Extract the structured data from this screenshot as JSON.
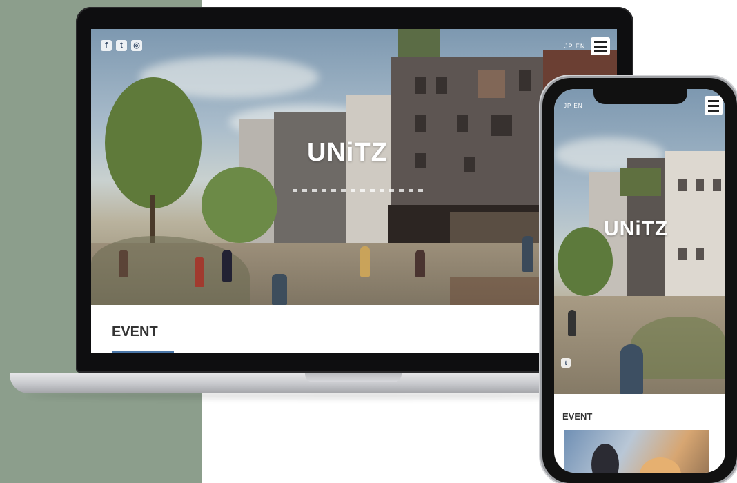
{
  "laptop": {
    "logo": "UNiTZ",
    "lang": "JP EN",
    "section_title": "EVENT",
    "social_icons": [
      "facebook-icon",
      "twitter-icon",
      "instagram-icon"
    ]
  },
  "phone": {
    "logo": "UNiTZ",
    "lang": "JP EN",
    "section_title": "EVENT"
  },
  "colors": {
    "background_left": "#8c9e8c",
    "background_right": "#ffffff",
    "device_frame": "#0e0e10"
  }
}
